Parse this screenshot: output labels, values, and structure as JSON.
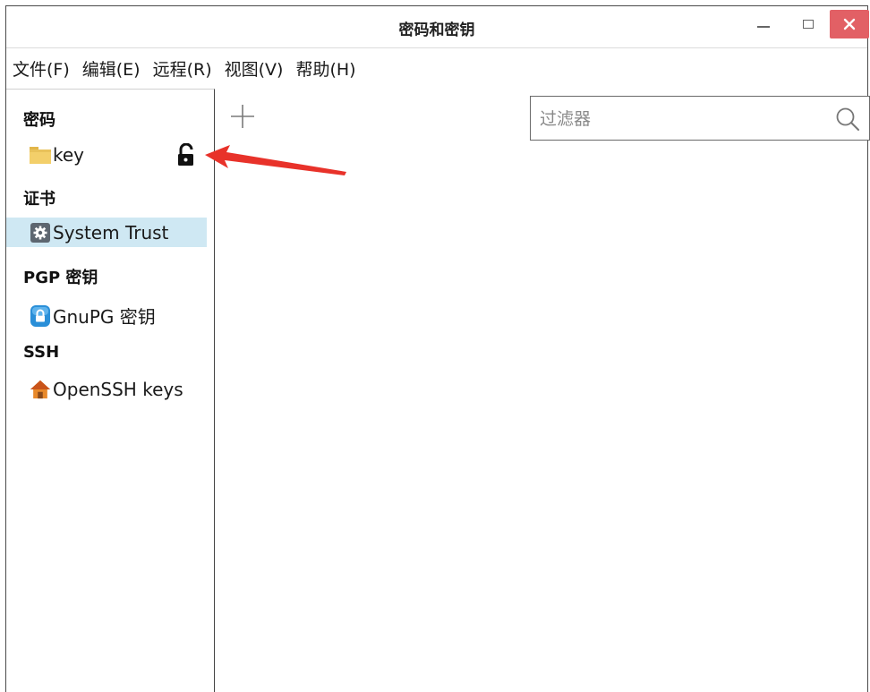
{
  "window": {
    "title": "密码和密钥"
  },
  "menu": [
    {
      "label": "文件(F)"
    },
    {
      "label": "编辑(E)"
    },
    {
      "label": "远程(R)"
    },
    {
      "label": "视图(V)"
    },
    {
      "label": "帮助(H)"
    }
  ],
  "sidebar": {
    "sections": {
      "passwords": "密码",
      "certificates": "证书",
      "pgp": "PGP 密钥",
      "ssh": "SSH"
    },
    "items": {
      "key": {
        "label": "key",
        "icon": "folder-icon",
        "status_icon": "unlocked-padlock-icon"
      },
      "system_trust": {
        "label": "System Trust",
        "icon": "gear-icon",
        "selected": true
      },
      "gnupg": {
        "label": "GnuPG 密钥",
        "icon": "gnupg-keyring-icon"
      },
      "openssh": {
        "label": "OpenSSH keys",
        "icon": "home-icon"
      }
    }
  },
  "toolbar": {
    "add_icon": "plus-icon"
  },
  "filter": {
    "placeholder": "过滤器",
    "value": ""
  },
  "colors": {
    "selected_bg": "#cfe8f3",
    "close_button": "#e26065",
    "annotation_arrow": "#e8322a"
  }
}
